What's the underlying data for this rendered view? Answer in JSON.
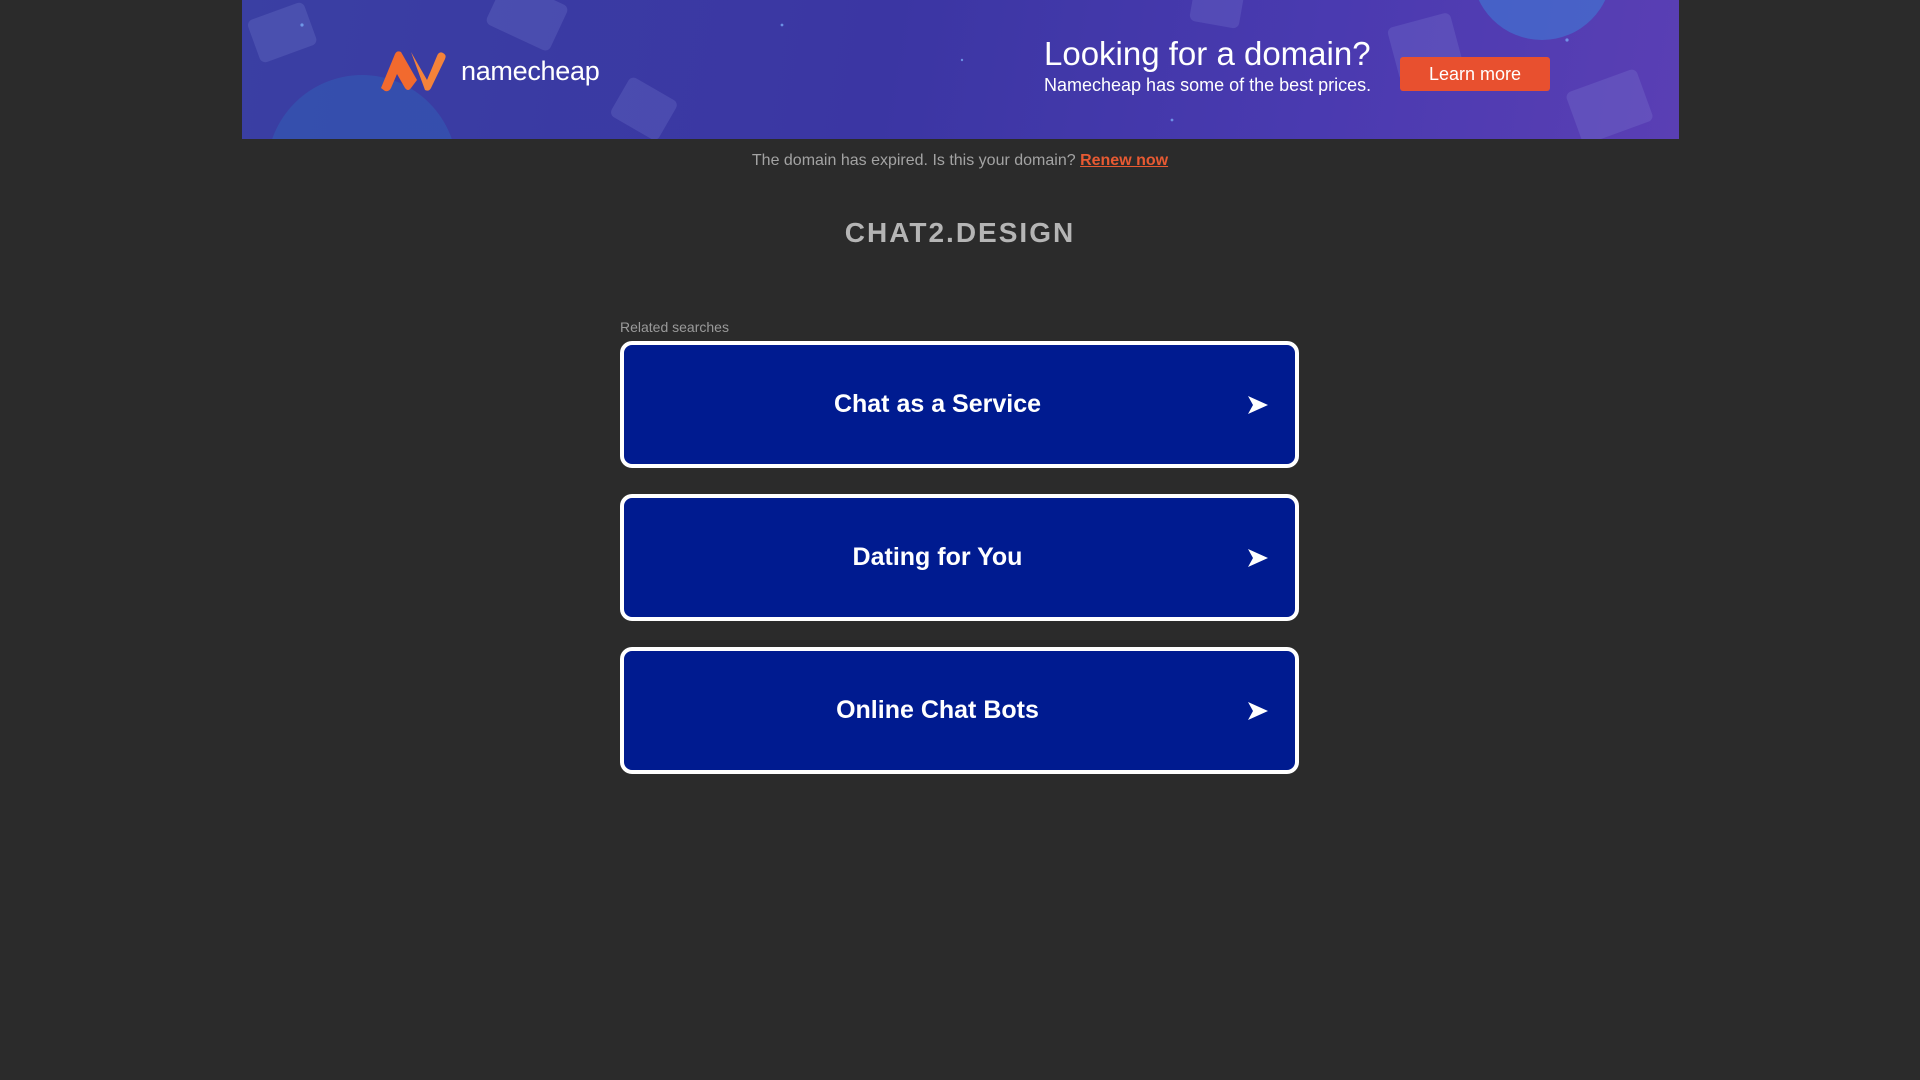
{
  "banner": {
    "logo_text": "namecheap",
    "headline": "Looking for a domain?",
    "subline": "Namecheap has some of the best prices.",
    "cta_label": "Learn more",
    "colors": {
      "background": "#3b36a3",
      "cta": "#e8502f",
      "logo_mark": "#f26a2e"
    }
  },
  "notice": {
    "text": "The domain has expired. Is this your domain?",
    "link_label": "Renew now",
    "link_color": "#e85a32"
  },
  "domain": {
    "name": "CHAT2.DESIGN"
  },
  "related": {
    "label": "Related searches",
    "items": [
      {
        "label": "Chat as a Service",
        "icon": "arrow-right-icon"
      },
      {
        "label": "Dating for You",
        "icon": "arrow-right-icon"
      },
      {
        "label": "Online Chat Bots",
        "icon": "arrow-right-icon"
      }
    ],
    "colors": {
      "button_bg": "#001b90",
      "button_border": "#ffffff"
    }
  },
  "page": {
    "background": "#2b2b2b"
  }
}
